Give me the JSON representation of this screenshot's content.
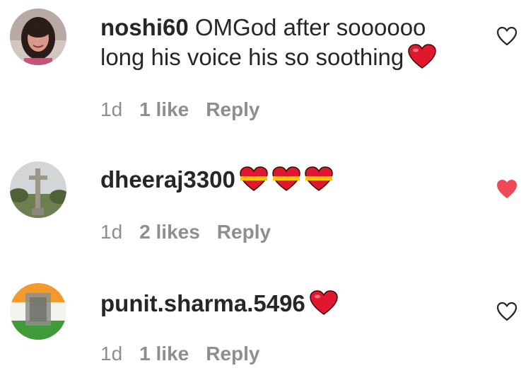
{
  "comments": [
    {
      "username": "noshi60",
      "line1": "OMGod after soooooo",
      "line2": "long his voice his so soothing",
      "time": "1d",
      "likes": "1 like",
      "reply": "Reply",
      "emojis": [
        "red-heart"
      ],
      "liked": false
    },
    {
      "username": "dheeraj3300",
      "line1": "",
      "time": "1d",
      "likes": "2 likes",
      "reply": "Reply",
      "emojis": [
        "heart-with-ribbon",
        "heart-with-ribbon",
        "heart-with-ribbon"
      ],
      "liked": true
    },
    {
      "username": "punit.sharma.5496",
      "line1": "",
      "time": "1d",
      "likes": "1 like",
      "reply": "Reply",
      "emojis": [
        "red-heart"
      ],
      "liked": false
    }
  ],
  "colors": {
    "text": "#262626",
    "meta": "#8e8e8e",
    "like_active": "#ed4956",
    "heart_emoji": "#e0172d"
  }
}
